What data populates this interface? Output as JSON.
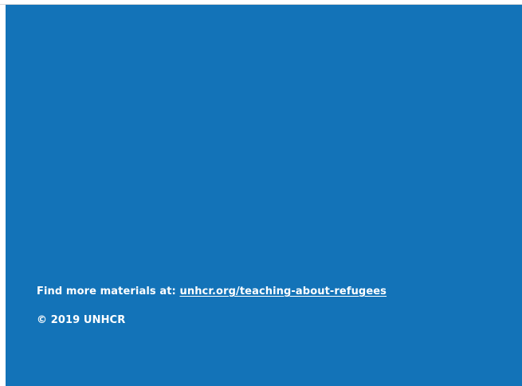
{
  "footer": {
    "materials_prefix": "Find more materials at: ",
    "materials_link": "unhcr.org/teaching-about-refugees",
    "copyright": "© 2019 UNHCR"
  },
  "colors": {
    "panel_background": "#1373b8",
    "text": "#ffffff"
  }
}
